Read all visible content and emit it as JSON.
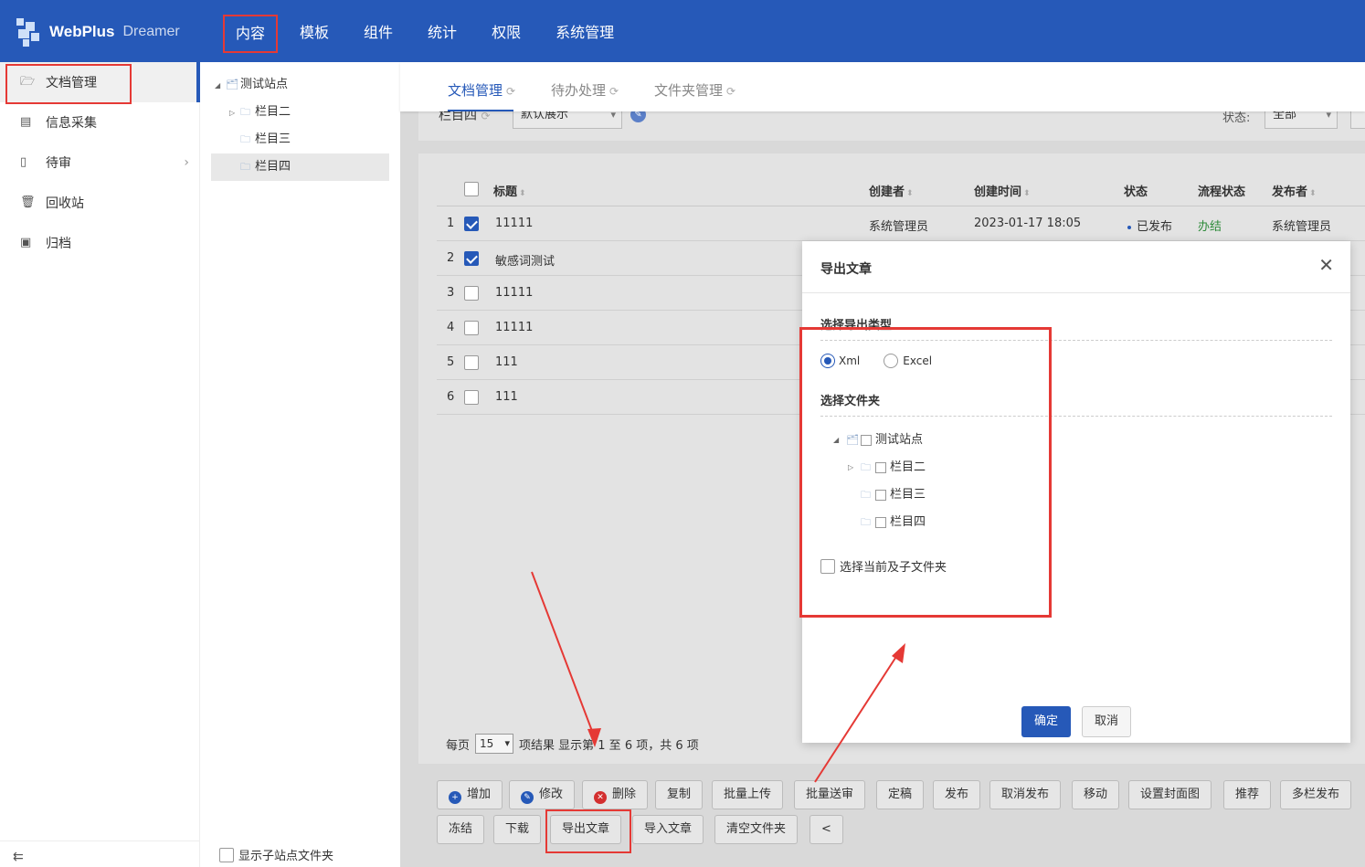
{
  "header": {
    "logo_text": "WebPlus",
    "logo_sub": "Dreamer",
    "nav": [
      "内容",
      "模板",
      "组件",
      "统计",
      "权限",
      "系统管理"
    ]
  },
  "sidebar": {
    "items": [
      {
        "label": "文档管理",
        "icon": "folder-open-icon"
      },
      {
        "label": "信息采集",
        "icon": "document-icon"
      },
      {
        "label": "待审",
        "icon": "lock-document-icon"
      },
      {
        "label": "回收站",
        "icon": "trash-icon"
      },
      {
        "label": "归档",
        "icon": "archive-icon"
      }
    ]
  },
  "tree": {
    "root": "测试站点",
    "children": [
      "栏目二",
      "栏目三",
      "栏目四"
    ],
    "show_subsite": "显示子站点文件夹"
  },
  "tabs": [
    "文档管理",
    "待办处理",
    "文件夹管理"
  ],
  "filter": {
    "column": "栏目四",
    "view": "默认展示",
    "status_label": "状态:",
    "status_value": "全部"
  },
  "table": {
    "headers": [
      "标题",
      "创建者",
      "创建时间",
      "状态",
      "流程状态",
      "发布者"
    ],
    "rows": [
      {
        "no": "1",
        "title": "11111",
        "creator": "系统管理员",
        "time": "2023-01-17 18:05",
        "status": "已发布",
        "flow": "办结",
        "publisher": "系统管理员",
        "checked": true
      },
      {
        "no": "2",
        "title": "敏感词测试",
        "checked": true
      },
      {
        "no": "3",
        "title": "11111",
        "checked": false
      },
      {
        "no": "4",
        "title": "11111",
        "checked": false
      },
      {
        "no": "5",
        "title": "111",
        "checked": false
      },
      {
        "no": "6",
        "title": "111",
        "checked": false
      }
    ]
  },
  "pager": {
    "per_page_label": "每页",
    "per_page": "15",
    "summary": "项结果 显示第 1 至 6 项，共 6 项"
  },
  "buttons_row1": [
    "增加",
    "修改",
    "删除",
    "复制",
    "批量上传",
    "批量送审",
    "定稿",
    "发布",
    "取消发布",
    "移动",
    "设置封面图",
    "推荐",
    "多栏发布"
  ],
  "buttons_row2": [
    "冻结",
    "下载",
    "导出文章",
    "导入文章",
    "清空文件夹",
    "<"
  ],
  "dialog": {
    "title": "导出文章",
    "export_type_label": "选择导出类型",
    "option_xml": "Xml",
    "option_excel": "Excel",
    "folder_label": "选择文件夹",
    "tree_root": "测试站点",
    "tree_children": [
      "栏目二",
      "栏目三",
      "栏目四"
    ],
    "include_sub": "选择当前及子文件夹",
    "ok": "确定",
    "cancel": "取消"
  },
  "colors": {
    "primary": "#2659b8",
    "highlight": "#e53935",
    "success": "#2e8b3a"
  }
}
